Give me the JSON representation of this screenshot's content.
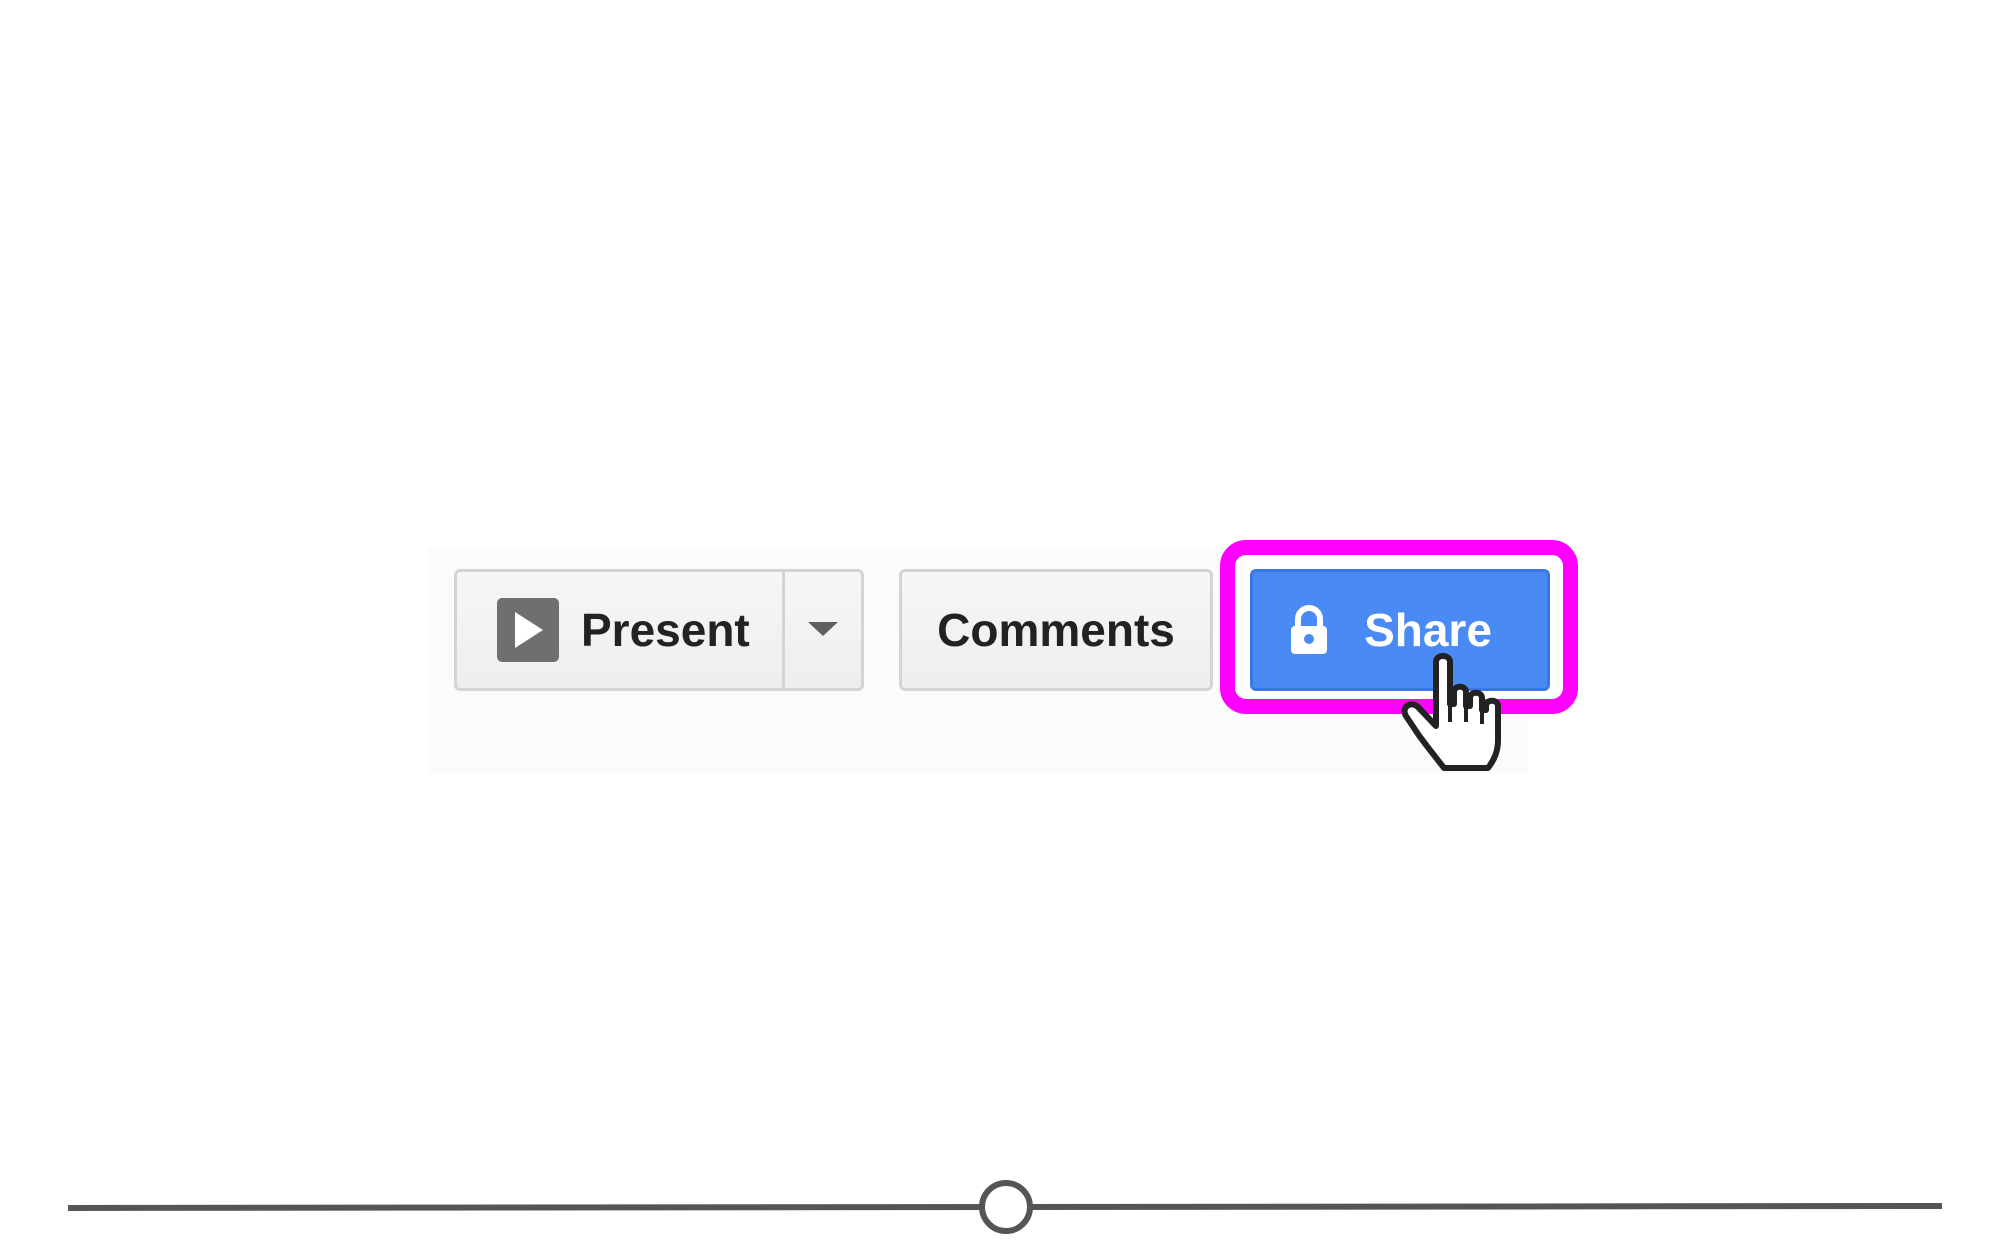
{
  "toolbar": {
    "present_label": "Present",
    "comments_label": "Comments",
    "share_label": "Share"
  },
  "icons": {
    "present": "play-icon",
    "present_menu": "chevron-down-icon",
    "share": "lock-icon",
    "cursor": "hand-pointer-icon",
    "scrubber": "slider-handle"
  },
  "colors": {
    "share_button": "#4a8af4",
    "highlight": "#ff00ff",
    "button_border": "#d4d4d4",
    "icon_gray": "#6f6f6f"
  },
  "timeline": {
    "position": 0.5
  }
}
